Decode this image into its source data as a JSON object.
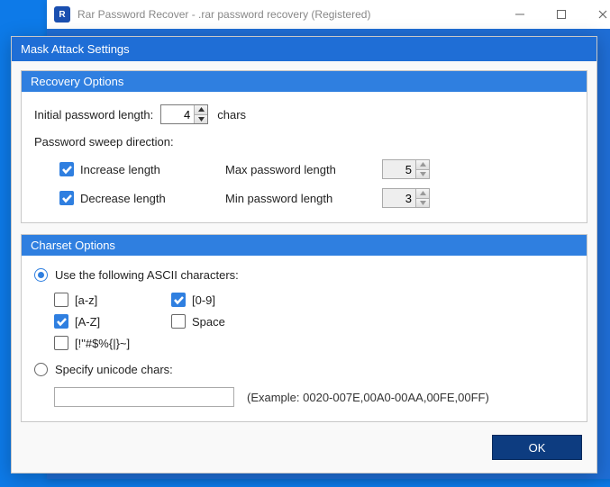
{
  "window": {
    "title": "Rar Password Recover - .rar password recovery (Registered)"
  },
  "dialog": {
    "title": "Mask Attack Settings"
  },
  "recovery": {
    "group_title": "Recovery Options",
    "initial_label": "Initial password length:",
    "initial_value": "4",
    "chars_suffix": "chars",
    "sweep_label": "Password sweep direction:",
    "increase_label": "Increase length",
    "increase_checked": true,
    "max_label": "Max password length",
    "max_value": "5",
    "decrease_label": "Decrease length",
    "decrease_checked": true,
    "min_label": "Min password length",
    "min_value": "3"
  },
  "charset": {
    "group_title": "Charset Options",
    "ascii_label": "Use the following ASCII characters:",
    "ascii_selected": true,
    "items": {
      "az": {
        "label": "[a-z]",
        "checked": false
      },
      "AZ": {
        "label": "[A-Z]",
        "checked": true
      },
      "digits": {
        "label": "[0-9]",
        "checked": true
      },
      "space": {
        "label": "Space",
        "checked": false
      },
      "symbols": {
        "label": "[!\"#$%{|}~]",
        "checked": false
      }
    },
    "unicode_label": "Specify unicode chars:",
    "unicode_selected": false,
    "unicode_value": "",
    "example": "(Example: 0020-007E,00A0-00AA,00FE,00FF)"
  },
  "buttons": {
    "ok": "OK"
  }
}
